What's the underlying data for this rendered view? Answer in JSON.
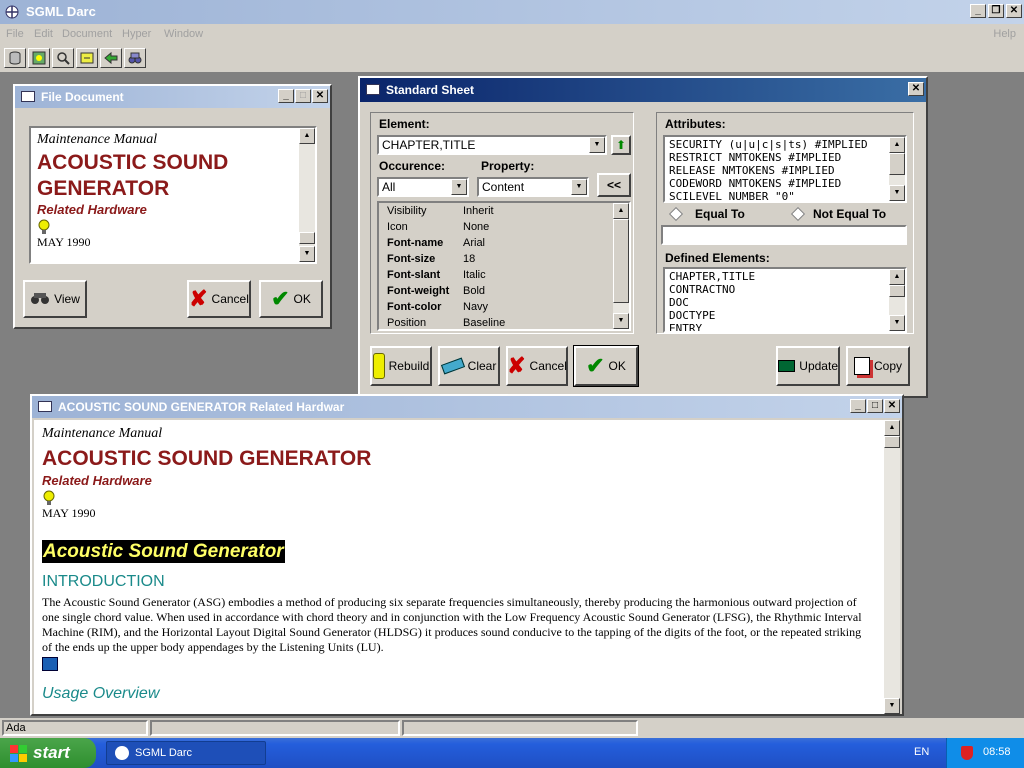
{
  "app": {
    "title": "SGML Darc",
    "menu": [
      "File",
      "Edit",
      "Document",
      "Hyper",
      "Window"
    ],
    "help": "Help",
    "toolbar_icons": [
      "database-icon",
      "settings-icon",
      "find-icon",
      "open-icon",
      "back-icon",
      "binoculars-icon"
    ]
  },
  "file_document": {
    "title": "File Document",
    "maint": "Maintenance Manual",
    "title1": "ACOUSTIC SOUND",
    "title2": "GENERATOR",
    "sub": "Related Hardware",
    "date": "MAY 1990",
    "view": "View",
    "cancel": "Cancel",
    "ok": "OK"
  },
  "standard_sheet": {
    "title": "Standard Sheet",
    "element_label": "Element:",
    "element_value": "CHAPTER,TITLE",
    "occurrence_label": "Occurence:",
    "occurrence_value": "All",
    "property_label": "Property:",
    "property_value": "Content",
    "back": "<<",
    "properties": [
      {
        "k": "Visibility",
        "v": "Inherit",
        "b": false
      },
      {
        "k": "Icon",
        "v": "None",
        "b": false
      },
      {
        "k": "Font-name",
        "v": "Arial",
        "b": true
      },
      {
        "k": "Font-size",
        "v": "18",
        "b": true
      },
      {
        "k": "Font-slant",
        "v": "Italic",
        "b": true
      },
      {
        "k": "Font-weight",
        "v": "Bold",
        "b": true
      },
      {
        "k": "Font-color",
        "v": "Navy",
        "b": true
      },
      {
        "k": "Position",
        "v": "Baseline",
        "b": false
      }
    ],
    "attributes_label": "Attributes:",
    "attributes": [
      "SECURITY (u|u|c|s|ts) #IMPLIED",
      "RESTRICT NMTOKENS #IMPLIED",
      "RELEASE NMTOKENS #IMPLIED",
      "CODEWORD NMTOKENS #IMPLIED",
      "SCILEVEL NUMBER \"0\""
    ],
    "equal_to": "Equal To",
    "not_equal_to": "Not Equal To",
    "defined_label": "Defined Elements:",
    "defined": [
      "CHAPTER,TITLE",
      "CONTRACTNO",
      "DOC",
      "DOCTYPE",
      "ENTRY"
    ],
    "rebuild": "Rebuild",
    "clear": "Clear",
    "cancel": "Cancel",
    "ok": "OK",
    "update": "Update",
    "copy": "Copy"
  },
  "main_doc": {
    "title": "ACOUSTIC SOUND GENERATOR Related Hardwar",
    "maint": "Maintenance Manual",
    "heading": "ACOUSTIC SOUND GENERATOR",
    "sub": "Related Hardware",
    "date": "MAY 1990",
    "highlight": "Acoustic Sound Generator",
    "intro": "INTRODUCTION",
    "para": "The Acoustic Sound Generator (ASG) embodies a method of producing six separate frequencies simultaneously, thereby producing the harmonious outward projection of one single chord value. When used in accordance with chord theory and in conjunction with the Low Frequency Acoustic Sound Generator (LFSG), the Rhythmic Interval Machine (RIM), and the Horizontal Layout Digital Sound Generator (HLDSG) it produces sound conducive to the tapping of the digits of the foot, or the repeated striking of the ends up the upper body appendages by the Listening Units (LU).",
    "next_heading": "Usage Overview"
  },
  "status": {
    "text": "Ada"
  },
  "taskbar": {
    "start": "start",
    "task": "SGML Darc",
    "lang": "EN",
    "time": "08:58"
  },
  "colors": {
    "title_active": "#0a246a",
    "doc_red": "#8b1a1a",
    "intro_teal": "#1a8a8a",
    "highlight_bg": "#000000",
    "highlight_fg": "#ffff66"
  }
}
